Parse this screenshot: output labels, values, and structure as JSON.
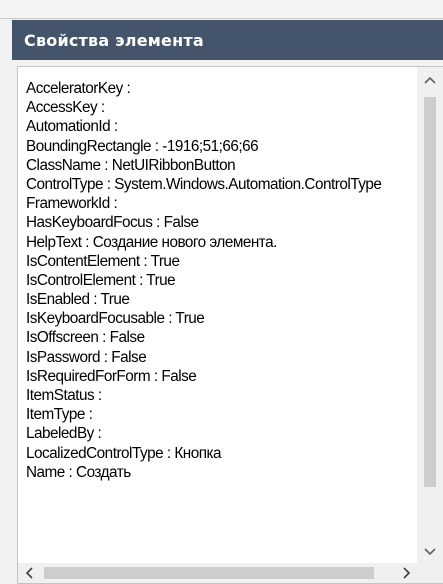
{
  "panel": {
    "title": "Свойства элемента"
  },
  "properties": [
    "AcceleratorKey :",
    "AccessKey :",
    "AutomationId :",
    "BoundingRectangle : -1916;51;66;66",
    "ClassName : NetUIRibbonButton",
    "ControlType : System.Windows.Automation.ControlType",
    "FrameworkId :",
    "HasKeyboardFocus : False",
    "HelpText : Создание нового элемента.",
    "IsContentElement : True",
    "IsControlElement : True",
    "IsEnabled : True",
    "IsKeyboardFocusable : True",
    "IsOffscreen : False",
    "IsPassword : False",
    "IsRequiredForForm : False",
    "ItemStatus :",
    "ItemType :",
    "LabeledBy :",
    "LocalizedControlType : Кнопка",
    "Name : Создать"
  ],
  "icons": {
    "scroll_up": "chevron-up-icon",
    "scroll_down": "chevron-down-icon",
    "scroll_left": "chevron-left-icon",
    "scroll_right": "chevron-right-icon"
  },
  "colors": {
    "header_bg": "#44546a",
    "header_text": "#ffffff",
    "panel_bg": "#ffffff",
    "scrollbar_thumb": "#cdcdcd"
  }
}
